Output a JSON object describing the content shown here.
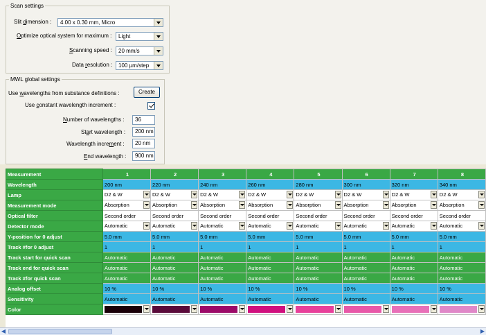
{
  "scan": {
    "legend": "Scan settings",
    "slit_label_pre": "Slit ",
    "slit_label_u": "d",
    "slit_label_post": "imension :",
    "slit_value": "4.00 x 0.30 mm, Micro",
    "optimize_label_u": "O",
    "optimize_label_post": "ptimize optical system for maximum :",
    "optimize_value": "Light",
    "speed_label_u": "S",
    "speed_label_post": "canning speed :",
    "speed_value": "20 mm/s",
    "resolution_label_pre": "Data ",
    "resolution_label_u": "r",
    "resolution_label_post": "esolution :",
    "resolution_value": "100 µm/step"
  },
  "mwl": {
    "legend": "MWL global settings",
    "use_wl_pre": "Use ",
    "use_wl_u": "w",
    "use_wl_post": "avelengths from substance definitions :",
    "create_label": "Create",
    "const_pre": "Use ",
    "const_u": "c",
    "const_post": "onstant wavelength increment :",
    "const_checked": true,
    "num_u": "N",
    "num_post": "umber of wavelengths :",
    "num_value": "36",
    "start_pre": "St",
    "start_u": "a",
    "start_post": "rt wavelength :",
    "start_value": "200 nm",
    "inc_pre": "Wavelength incre",
    "inc_u": "m",
    "inc_post": "ent :",
    "inc_value": "20 nm",
    "end_u": "E",
    "end_post": "nd wavelength :",
    "end_value": "900 nm"
  },
  "grid": {
    "header_label": "Measurement",
    "columns": [
      "1",
      "2",
      "3",
      "4",
      "5",
      "6",
      "7",
      "8"
    ],
    "rows": [
      {
        "label": "Wavelength",
        "style": "blue",
        "kind": "text",
        "values": [
          "200 nm",
          "220 nm",
          "240 nm",
          "260 nm",
          "280 nm",
          "300 nm",
          "320 nm",
          "340 nm"
        ]
      },
      {
        "label": "Lamp",
        "style": "white",
        "kind": "combo",
        "values": [
          "D2 & W",
          "D2 & W",
          "D2 & W",
          "D2 & W",
          "D2 & W",
          "D2 & W",
          "D2 & W",
          "D2 & W"
        ]
      },
      {
        "label": "Measurement mode",
        "style": "white",
        "kind": "combo",
        "values": [
          "Absorption",
          "Absorption",
          "Absorption",
          "Absorption",
          "Absorption",
          "Absorption",
          "Absorption",
          "Absorption"
        ]
      },
      {
        "label": "Optical filter",
        "style": "white",
        "kind": "text",
        "values": [
          "Second order",
          "Second order",
          "Second order",
          "Second order",
          "Second order",
          "Second order",
          "Second order",
          "Second order"
        ]
      },
      {
        "label": "Detector mode",
        "style": "white",
        "kind": "combo",
        "values": [
          "Automatic",
          "Automatic",
          "Automatic",
          "Automatic",
          "Automatic",
          "Automatic",
          "Automatic",
          "Automatic"
        ]
      },
      {
        "label": "Y-position for 0 adjust",
        "style": "blue",
        "kind": "text",
        "values": [
          "5.0 mm",
          "5.0 mm",
          "5.0 mm",
          "5.0 mm",
          "5.0 mm",
          "5.0 mm",
          "5.0 mm",
          "5.0 mm"
        ]
      },
      {
        "label": "Track #for 0 adjust",
        "style": "blue",
        "kind": "text",
        "values": [
          "1",
          "1",
          "1",
          "1",
          "1",
          "1",
          "1",
          "1"
        ]
      },
      {
        "label": "Track start for quick scan",
        "style": "green",
        "kind": "text",
        "values": [
          "Automatic",
          "Automatic",
          "Automatic",
          "Automatic",
          "Automatic",
          "Automatic",
          "Automatic",
          "Automatic"
        ]
      },
      {
        "label": "Track end for quick scan",
        "style": "green",
        "kind": "text",
        "values": [
          "Automatic",
          "Automatic",
          "Automatic",
          "Automatic",
          "Automatic",
          "Automatic",
          "Automatic",
          "Automatic"
        ]
      },
      {
        "label": "Track #for quick scan",
        "style": "green",
        "kind": "text",
        "values": [
          "Automatic",
          "Automatic",
          "Automatic",
          "Automatic",
          "Automatic",
          "Automatic",
          "Automatic",
          "Automatic"
        ]
      },
      {
        "label": "Analog offset",
        "style": "blue",
        "kind": "text",
        "values": [
          "10 %",
          "10 %",
          "10 %",
          "10 %",
          "10 %",
          "10 %",
          "10 %",
          "10 %"
        ]
      },
      {
        "label": "Sensitivity",
        "style": "blue",
        "kind": "text",
        "values": [
          "Automatic",
          "Automatic",
          "Automatic",
          "Automatic",
          "Automatic",
          "Automatic",
          "Automatic",
          "Automatic"
        ]
      },
      {
        "label": "Color",
        "style": "white",
        "kind": "color",
        "values": [
          "#1a0008",
          "#5a0a3a",
          "#9c0a68",
          "#d0107e",
          "#e8409a",
          "#e858a8",
          "#e870b8",
          "#e088c8"
        ]
      }
    ]
  }
}
